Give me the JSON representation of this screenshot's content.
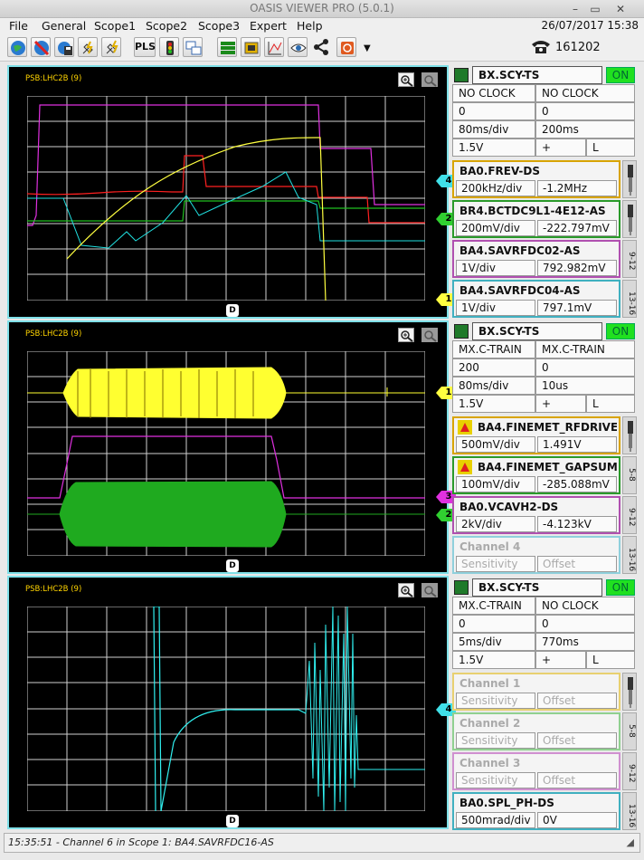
{
  "window": {
    "title": "OASIS VIEWER PRO (5.0.1)"
  },
  "menu": {
    "items": [
      "File",
      "General",
      "Scope1",
      "Scope2",
      "Scope3",
      "Expert",
      "Help"
    ],
    "datetime": "26/07/2017 15:38"
  },
  "toolbar": {
    "pls_label": "PLS",
    "phone_number": "161202"
  },
  "scopes": [
    {
      "label": "PSB:LHC2B (9)",
      "markers": [
        "4",
        "2",
        "1"
      ],
      "d_marker": "D",
      "panel": {
        "source": "BX.SCY-TS",
        "state": "ON",
        "rows": [
          [
            "NO CLOCK",
            "NO CLOCK"
          ],
          [
            "0",
            "0"
          ],
          [
            "80ms/div",
            "200ms"
          ],
          [
            "1.5V",
            "+",
            "L"
          ]
        ],
        "channels": [
          {
            "name": "BA0.FREV-DS",
            "sens": "200kHz/div",
            "offset": "-1.2MHz",
            "color": "#d8a400",
            "tag": ""
          },
          {
            "name": "BR4.BCTDC9L1-4E12-AS",
            "sens": "200mV/div",
            "offset": "-222.797mV",
            "color": "#2a9a2a",
            "tag": ""
          },
          {
            "name": "BA4.SAVRFDC02-AS",
            "sens": "1V/div",
            "offset": "792.982mV",
            "color": "#b050b0",
            "tag": "9-12"
          },
          {
            "name": "BA4.SAVRFDC04-AS",
            "sens": "1V/div",
            "offset": "797.1mV",
            "color": "#40b0c0",
            "tag": "13-16"
          }
        ]
      }
    },
    {
      "label": "PSB:LHC2B (9)",
      "markers": [
        "1",
        "3",
        "2"
      ],
      "d_marker": "D",
      "panel": {
        "source": "BX.SCY-TS",
        "state": "ON",
        "rows": [
          [
            "MX.C-TRAIN",
            "MX.C-TRAIN"
          ],
          [
            "200",
            "0"
          ],
          [
            "80ms/div",
            "10us"
          ],
          [
            "1.5V",
            "+",
            "L"
          ]
        ],
        "channels": [
          {
            "name": "BA4.FINEMET_RFDRIVE...",
            "sens": "500mV/div",
            "offset": "1.491V",
            "color": "#d8a400",
            "tag": ""
          },
          {
            "name": "BA4.FINEMET_GAPSUM...",
            "sens": "100mV/div",
            "offset": "-285.088mV",
            "color": "#2a9a2a",
            "tag": "5-8"
          },
          {
            "name": "BA0.VCAVH2-DS",
            "sens": "2kV/div",
            "offset": "-4.123kV",
            "color": "#b050b0",
            "tag": "9-12"
          },
          {
            "name": "Channel 4",
            "sens": "Sensitivity",
            "offset": "Offset",
            "color": "#8fd0dc",
            "tag": "13-16",
            "off": true
          }
        ]
      }
    },
    {
      "label": "PSB:LHC2B (9)",
      "markers": [
        "4"
      ],
      "d_marker": "D",
      "panel": {
        "source": "BX.SCY-TS",
        "state": "ON",
        "rows": [
          [
            "MX.C-TRAIN",
            "NO CLOCK"
          ],
          [
            "0",
            "0"
          ],
          [
            "5ms/div",
            "770ms"
          ],
          [
            "1.5V",
            "+",
            "L"
          ]
        ],
        "channels": [
          {
            "name": "Channel 1",
            "sens": "Sensitivity",
            "offset": "Offset",
            "color": "#e8d070",
            "tag": "",
            "off": true
          },
          {
            "name": "Channel 2",
            "sens": "Sensitivity",
            "offset": "Offset",
            "color": "#90d090",
            "tag": "5-8",
            "off": true
          },
          {
            "name": "Channel 3",
            "sens": "Sensitivity",
            "offset": "Offset",
            "color": "#d090d0",
            "tag": "9-12",
            "off": true
          },
          {
            "name": "BA0.SPL_PH-DS",
            "sens": "500mrad/div",
            "offset": "0V",
            "color": "#40b0c0",
            "tag": "13-16"
          }
        ]
      }
    }
  ],
  "status": {
    "text": "15:35:51 - Channel 6 in Scope 1: BA4.SAVRFDC16-AS"
  },
  "colors": {
    "frame": "#7fe0e8",
    "on": "#20e020",
    "grid": "#d8d8d8"
  }
}
